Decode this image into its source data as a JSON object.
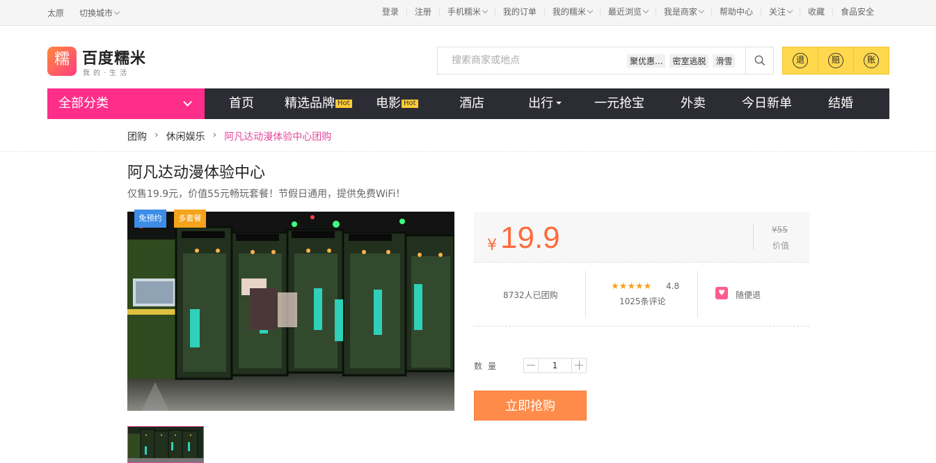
{
  "topbar": {
    "city": "太原",
    "switch_city": "切换城市",
    "links": [
      "登录",
      "注册",
      "手机糯米",
      "我的订单",
      "我的糯米",
      "最近浏览",
      "我是商家",
      "帮助中心",
      "关注",
      "收藏",
      "食品安全"
    ]
  },
  "header": {
    "logo_glyph": "糯",
    "logo_name": "百度糯米",
    "slogan": "我的·生活",
    "search_placeholder": "搜索商家或地点",
    "hot_tags": [
      "聚优惠...",
      "密室逃脱",
      "滑雪"
    ],
    "badges": [
      "退",
      "赔",
      "账"
    ]
  },
  "nav": {
    "category": "全部分类",
    "items": [
      {
        "label": "首页",
        "hot": ""
      },
      {
        "label": "精选品牌",
        "hot": "Hot"
      },
      {
        "label": "电影",
        "hot": "Hot"
      },
      {
        "label": "酒店",
        "hot": ""
      },
      {
        "label": "出行",
        "hot": ""
      },
      {
        "label": "一元抢宝",
        "hot": ""
      },
      {
        "label": "外卖",
        "hot": ""
      },
      {
        "label": "今日新单",
        "hot": ""
      },
      {
        "label": "结婚",
        "hot": ""
      }
    ]
  },
  "breadcrumb": [
    "团购",
    "休闲娱乐",
    "阿凡达动漫体验中心团购"
  ],
  "deal": {
    "title": "阿凡达动漫体验中心",
    "subtitle": "仅售19.9元，价值55元畅玩套餐！节假日通用，提供免费WiFi！",
    "tags": [
      "免预约",
      "多套餐"
    ],
    "currency": "¥",
    "price": "19.9",
    "original_price": "¥55",
    "original_label": "价值",
    "sold": "8732人已团购",
    "rating": 4.8,
    "score": "4.8",
    "reviews": "1025条评论",
    "refund": "随便退",
    "quantity_label": "数量",
    "quantity": "1",
    "buy_label": "立即抢购"
  },
  "colors": {
    "accent_pink": "#ff2e8a",
    "nav_dark": "#2c2c34",
    "price_orange": "#ff6b3d",
    "buy_orange": "#ff8b4a",
    "badge_yellow": "#ffd84d"
  }
}
